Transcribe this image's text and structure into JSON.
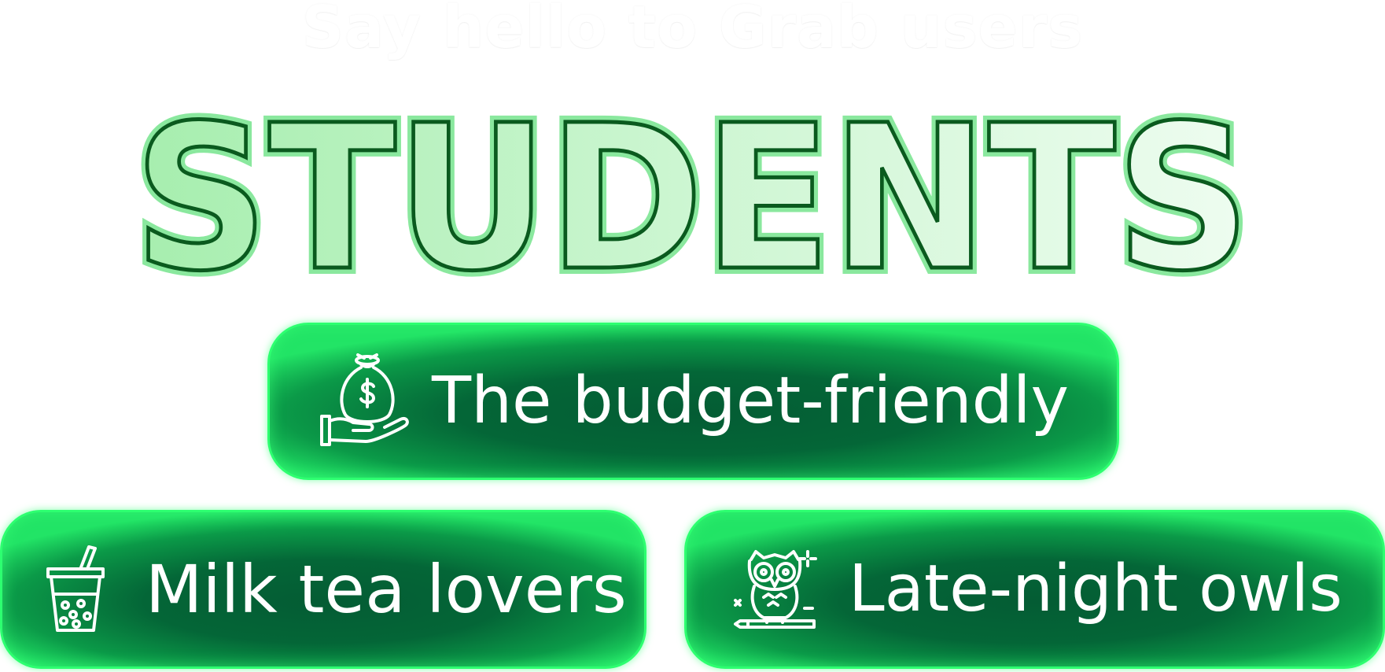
{
  "header": {
    "tagline": "Say hello to Grab users",
    "title": "STUDENTS"
  },
  "segments": [
    {
      "label": "The budget-friendly",
      "icon": "money-bag-hand-icon"
    },
    {
      "label": "Milk tea lovers",
      "icon": "bubble-tea-icon"
    },
    {
      "label": "Late-night owls",
      "icon": "owl-icon"
    }
  ],
  "colors": {
    "pill_dark": "#045c34",
    "pill_glow": "#2dff70",
    "title_fill_light": "#e8fbea",
    "title_fill_green": "#a8eeb0",
    "title_outline": "#0a5a1e"
  }
}
